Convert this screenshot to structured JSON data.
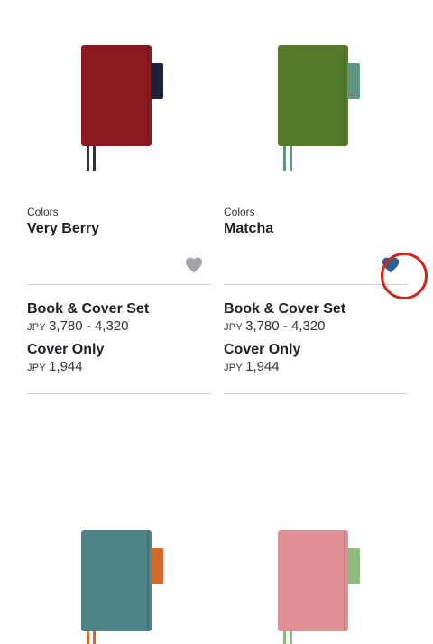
{
  "products": [
    {
      "category": "Colors",
      "name": "Very Berry",
      "favorited": false,
      "options": [
        {
          "title": "Book & Cover Set",
          "currency": "JPY",
          "price": "3,780 - 4,320"
        },
        {
          "title": "Cover Only",
          "currency": "JPY",
          "price": "1,944"
        }
      ],
      "colors": {
        "cover": "#8e1820",
        "pen": "#1e2238",
        "ribbon": "#2d3136"
      }
    },
    {
      "category": "Colors",
      "name": "Matcha",
      "favorited": true,
      "options": [
        {
          "title": "Book & Cover Set",
          "currency": "JPY",
          "price": "3,780 - 4,320"
        },
        {
          "title": "Cover Only",
          "currency": "JPY",
          "price": "1,944"
        }
      ],
      "colors": {
        "cover": "#557a2b",
        "pen": "#5f9480",
        "ribbon": "#5f9480"
      }
    },
    {
      "colors": {
        "cover": "#4f8486",
        "pen": "#d5692d",
        "ribbon": "#d5692d"
      }
    },
    {
      "colors": {
        "cover": "#e08f95",
        "pen": "#8fba7d",
        "ribbon": "#8fba7d"
      }
    }
  ],
  "ui": {
    "fav_inactive_color": "#a3a3ad",
    "fav_active_color": "#2f5f93",
    "highlight_color": "#d62418"
  }
}
